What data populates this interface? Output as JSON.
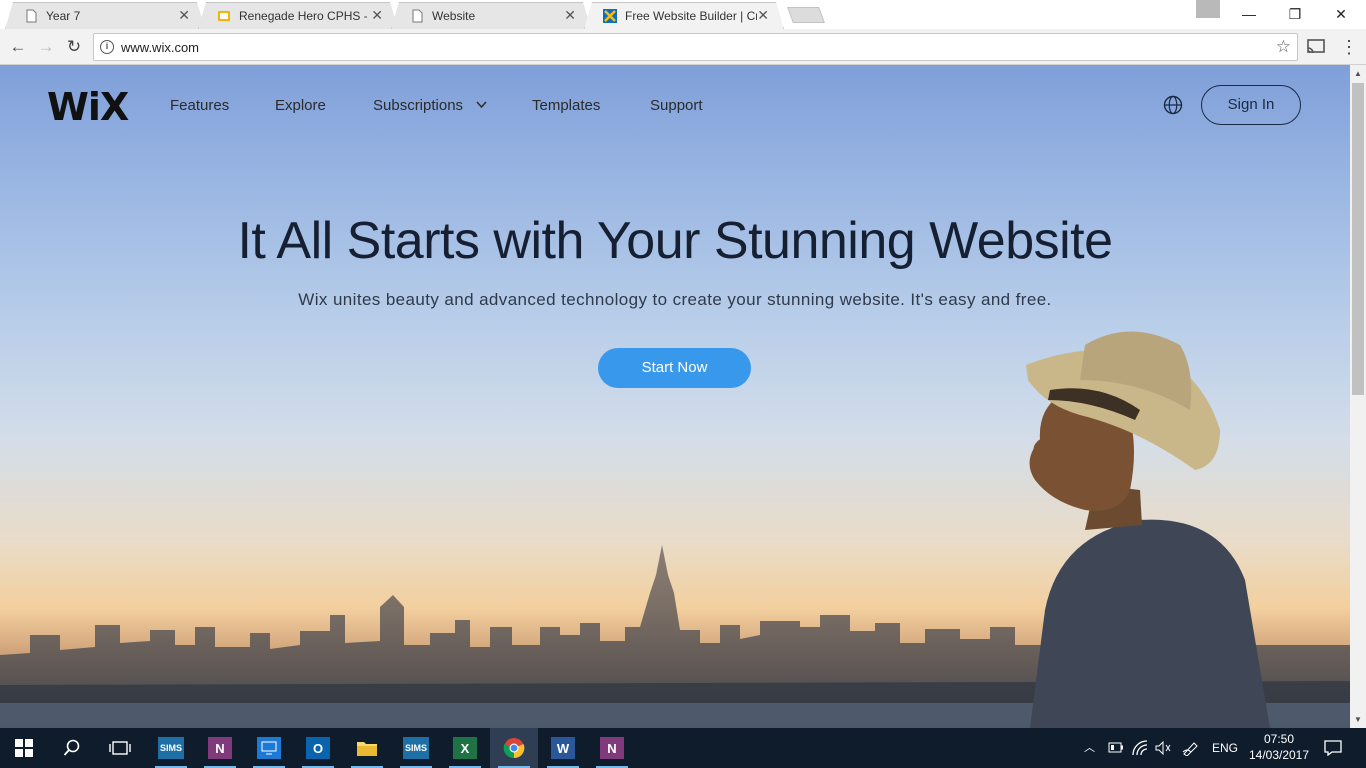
{
  "browser": {
    "tabs": [
      {
        "title": "Year 7",
        "icon": "page-icon"
      },
      {
        "title": "Renegade Hero CPHS - G",
        "icon": "slides-icon"
      },
      {
        "title": "Website",
        "icon": "page-icon"
      },
      {
        "title": "Free Website Builder | Cr",
        "icon": "wix-favicon",
        "active": true
      }
    ],
    "close_glyph": "✕",
    "url": "www.wix.com",
    "window_controls": {
      "minimize": "—",
      "restore": "❐",
      "close": "✕"
    }
  },
  "site": {
    "logo": "WiX",
    "nav": [
      "Features",
      "Explore",
      "Subscriptions",
      "Templates",
      "Support"
    ],
    "sign_in": "Sign In",
    "headline": "It All Starts with Your Stunning Website",
    "subline": "Wix unites beauty and advanced technology to create your stunning website. It's easy and free.",
    "cta": "Start Now"
  },
  "taskbar": {
    "apps": [
      "SIMS",
      "OneNote",
      "Remote Desktop",
      "Outlook",
      "File Explorer",
      "SIMS",
      "Excel",
      "Chrome",
      "Word",
      "OneNote"
    ],
    "tiles": {
      "sims_a": "SIMS",
      "onenote_a": "N",
      "outlook": "O",
      "sims_b": "SIMS",
      "excel": "X",
      "word": "W",
      "onenote_b": "N"
    },
    "language": "ENG",
    "time": "07:50",
    "date": "14/03/2017"
  },
  "colors": {
    "accent_blue": "#3899ec",
    "taskbar": "#0f1c2c",
    "headline": "#162032"
  }
}
